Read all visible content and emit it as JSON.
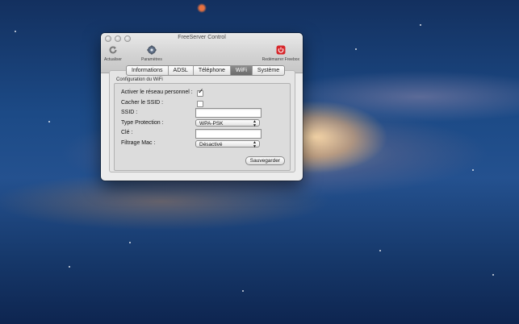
{
  "window": {
    "title": "FreeServer Control"
  },
  "toolbar": {
    "refresh_label": "Actualiser",
    "settings_label": "Paramètres",
    "reboot_label": "Redémarrer Freebox"
  },
  "tabs": [
    {
      "label": "Informations",
      "active": false
    },
    {
      "label": "ADSL",
      "active": false
    },
    {
      "label": "Téléphone",
      "active": false
    },
    {
      "label": "WiFi",
      "active": true
    },
    {
      "label": "Système",
      "active": false
    }
  ],
  "wifi": {
    "group_title": "Configuration du WiFi",
    "enable_label": "Activer le réseau personnel :",
    "enable_checked": true,
    "hide_ssid_label": "Cacher le SSID :",
    "hide_ssid_checked": false,
    "ssid_label": "SSID :",
    "ssid_value": "",
    "protection_label": "Type Protection :",
    "protection_value": "WPA-PSK",
    "key_label": "Clé :",
    "key_value": "",
    "mac_filter_label": "Filtrage Mac :",
    "mac_filter_value": "Désactivé",
    "save_label": "Sauvegarder"
  },
  "colors": {
    "reboot_icon": "#d7262a",
    "active_tab": "#7a7a7a"
  },
  "icons": {
    "refresh": "refresh-icon",
    "settings": "gear-icon",
    "reboot": "power-icon"
  }
}
